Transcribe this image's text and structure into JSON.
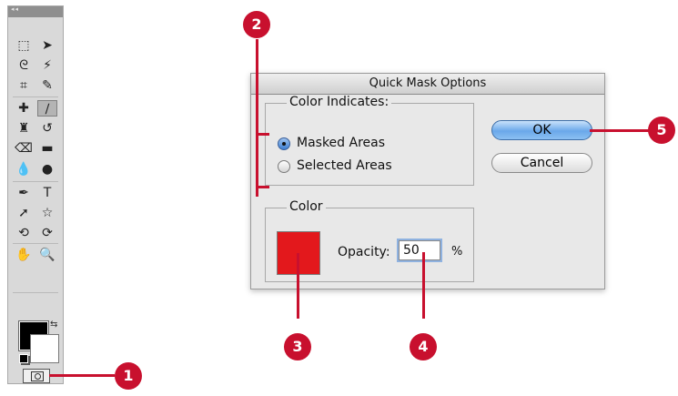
{
  "toolbox": {
    "title": "◂◂",
    "tools": [
      {
        "name": "marquee-tool-icon",
        "glyph": "⬚"
      },
      {
        "name": "move-tool-icon",
        "glyph": "➤"
      },
      {
        "name": "lasso-tool-icon",
        "glyph": "ᘓ"
      },
      {
        "name": "magic-wand-tool-icon",
        "glyph": "⚡"
      },
      {
        "name": "crop-tool-icon",
        "glyph": "⌗"
      },
      {
        "name": "eyedropper-tool-icon",
        "glyph": "✎"
      },
      {
        "name": "healing-brush-tool-icon",
        "glyph": "✚"
      },
      {
        "name": "brush-tool-icon",
        "glyph": "∕"
      },
      {
        "name": "clone-stamp-tool-icon",
        "glyph": "♜"
      },
      {
        "name": "history-brush-tool-icon",
        "glyph": "↺"
      },
      {
        "name": "eraser-tool-icon",
        "glyph": "⌫"
      },
      {
        "name": "gradient-tool-icon",
        "glyph": "▬"
      },
      {
        "name": "blur-tool-icon",
        "glyph": "💧"
      },
      {
        "name": "dodge-tool-icon",
        "glyph": "●"
      },
      {
        "name": "pen-tool-icon",
        "glyph": "✒"
      },
      {
        "name": "type-tool-icon",
        "glyph": "T"
      },
      {
        "name": "path-selection-tool-icon",
        "glyph": "➚"
      },
      {
        "name": "shape-tool-icon",
        "glyph": "☆"
      },
      {
        "name": "3d-rotate-tool-icon",
        "glyph": "⟲"
      },
      {
        "name": "3d-orbit-tool-icon",
        "glyph": "⟳"
      },
      {
        "name": "hand-tool-icon",
        "glyph": "✋"
      },
      {
        "name": "zoom-tool-icon",
        "glyph": "🔍"
      }
    ],
    "foreground_color": "#000000",
    "background_color": "#ffffff"
  },
  "dialog": {
    "title": "Quick Mask Options",
    "color_indicates": {
      "legend": "Color Indicates:",
      "options": [
        {
          "label": "Masked Areas",
          "selected": true
        },
        {
          "label": "Selected Areas",
          "selected": false
        }
      ]
    },
    "color_group": {
      "legend": "Color",
      "swatch_color": "#e3181c",
      "opacity_label": "Opacity:",
      "opacity_value": "50",
      "opacity_unit": "%"
    },
    "ok_label": "OK",
    "cancel_label": "Cancel"
  },
  "callouts": [
    "1",
    "2",
    "3",
    "4",
    "5"
  ],
  "colors": {
    "callout": "#c8102e",
    "ok_button": "#6aa8ea"
  }
}
